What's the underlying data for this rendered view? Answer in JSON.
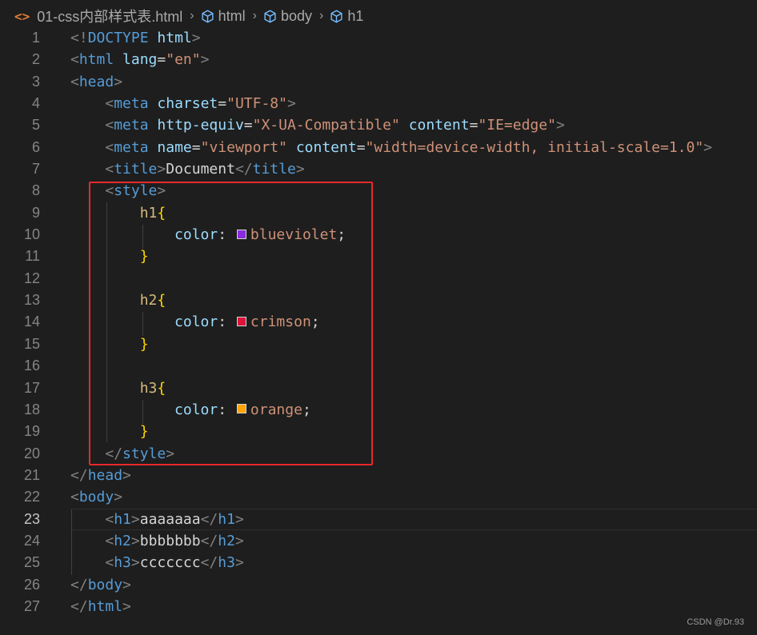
{
  "breadcrumb": {
    "file": "01-css内部样式表.html",
    "crumbs": [
      "html",
      "body",
      "h1"
    ]
  },
  "editor": {
    "active_line": 23,
    "lines": [
      {
        "n": "1",
        "tokens": [
          [
            "punc",
            "<!"
          ],
          [
            "tag",
            "DOCTYPE"
          ],
          [
            "text",
            " "
          ],
          [
            "attr",
            "html"
          ],
          [
            "punc",
            ">"
          ]
        ]
      },
      {
        "n": "2",
        "tokens": [
          [
            "punc",
            "<"
          ],
          [
            "tag",
            "html"
          ],
          [
            "text",
            " "
          ],
          [
            "attr",
            "lang"
          ],
          [
            "text",
            "="
          ],
          [
            "str",
            "\"en\""
          ],
          [
            "punc",
            ">"
          ]
        ]
      },
      {
        "n": "3",
        "tokens": [
          [
            "punc",
            "<"
          ],
          [
            "tag",
            "head"
          ],
          [
            "punc",
            ">"
          ]
        ]
      },
      {
        "n": "4",
        "tokens": [
          [
            "text",
            "    "
          ],
          [
            "punc",
            "<"
          ],
          [
            "tag",
            "meta"
          ],
          [
            "text",
            " "
          ],
          [
            "attr",
            "charset"
          ],
          [
            "text",
            "="
          ],
          [
            "str",
            "\"UTF-8\""
          ],
          [
            "punc",
            ">"
          ]
        ]
      },
      {
        "n": "5",
        "tokens": [
          [
            "text",
            "    "
          ],
          [
            "punc",
            "<"
          ],
          [
            "tag",
            "meta"
          ],
          [
            "text",
            " "
          ],
          [
            "attr",
            "http-equiv"
          ],
          [
            "text",
            "="
          ],
          [
            "str",
            "\"X-UA-Compatible\""
          ],
          [
            "text",
            " "
          ],
          [
            "attr",
            "content"
          ],
          [
            "text",
            "="
          ],
          [
            "str",
            "\"IE=edge\""
          ],
          [
            "punc",
            ">"
          ]
        ]
      },
      {
        "n": "6",
        "tokens": [
          [
            "text",
            "    "
          ],
          [
            "punc",
            "<"
          ],
          [
            "tag",
            "meta"
          ],
          [
            "text",
            " "
          ],
          [
            "attr",
            "name"
          ],
          [
            "text",
            "="
          ],
          [
            "str",
            "\"viewport\""
          ],
          [
            "text",
            " "
          ],
          [
            "attr",
            "content"
          ],
          [
            "text",
            "="
          ],
          [
            "str",
            "\"width=device-width, initial-scale=1.0\""
          ],
          [
            "punc",
            ">"
          ]
        ]
      },
      {
        "n": "7",
        "tokens": [
          [
            "text",
            "    "
          ],
          [
            "punc",
            "<"
          ],
          [
            "tag",
            "title"
          ],
          [
            "punc",
            ">"
          ],
          [
            "text",
            "Document"
          ],
          [
            "punc",
            "</"
          ],
          [
            "tag",
            "title"
          ],
          [
            "punc",
            ">"
          ]
        ]
      },
      {
        "n": "8",
        "tokens": [
          [
            "text",
            "    "
          ],
          [
            "punc",
            "<"
          ],
          [
            "tag",
            "style"
          ],
          [
            "punc",
            ">"
          ]
        ]
      },
      {
        "n": "9",
        "tokens": [
          [
            "text",
            "        "
          ],
          [
            "sel",
            "h1"
          ],
          [
            "brace",
            "{"
          ]
        ]
      },
      {
        "n": "10",
        "tokens": [
          [
            "text",
            "            "
          ],
          [
            "prop",
            "color"
          ],
          [
            "text",
            ": "
          ],
          [
            "swatch",
            "#8a2be2"
          ],
          [
            "val",
            "blueviolet"
          ],
          [
            "text",
            ";"
          ]
        ]
      },
      {
        "n": "11",
        "tokens": [
          [
            "text",
            "        "
          ],
          [
            "brace",
            "}"
          ]
        ]
      },
      {
        "n": "12",
        "tokens": []
      },
      {
        "n": "13",
        "tokens": [
          [
            "text",
            "        "
          ],
          [
            "sel",
            "h2"
          ],
          [
            "brace",
            "{"
          ]
        ]
      },
      {
        "n": "14",
        "tokens": [
          [
            "text",
            "            "
          ],
          [
            "prop",
            "color"
          ],
          [
            "text",
            ": "
          ],
          [
            "swatch",
            "#dc143c"
          ],
          [
            "val",
            "crimson"
          ],
          [
            "text",
            ";"
          ]
        ]
      },
      {
        "n": "15",
        "tokens": [
          [
            "text",
            "        "
          ],
          [
            "brace",
            "}"
          ]
        ]
      },
      {
        "n": "16",
        "tokens": []
      },
      {
        "n": "17",
        "tokens": [
          [
            "text",
            "        "
          ],
          [
            "sel",
            "h3"
          ],
          [
            "brace",
            "{"
          ]
        ]
      },
      {
        "n": "18",
        "tokens": [
          [
            "text",
            "            "
          ],
          [
            "prop",
            "color"
          ],
          [
            "text",
            ": "
          ],
          [
            "swatch",
            "#ffa500"
          ],
          [
            "val",
            "orange"
          ],
          [
            "text",
            ";"
          ]
        ]
      },
      {
        "n": "19",
        "tokens": [
          [
            "text",
            "        "
          ],
          [
            "brace",
            "}"
          ]
        ]
      },
      {
        "n": "20",
        "tokens": [
          [
            "text",
            "    "
          ],
          [
            "punc",
            "</"
          ],
          [
            "tag",
            "style"
          ],
          [
            "punc",
            ">"
          ]
        ]
      },
      {
        "n": "21",
        "tokens": [
          [
            "punc",
            "</"
          ],
          [
            "tag",
            "head"
          ],
          [
            "punc",
            ">"
          ]
        ]
      },
      {
        "n": "22",
        "tokens": [
          [
            "punc",
            "<"
          ],
          [
            "tag",
            "body"
          ],
          [
            "punc",
            ">"
          ]
        ]
      },
      {
        "n": "23",
        "tokens": [
          [
            "text",
            "    "
          ],
          [
            "punc",
            "<"
          ],
          [
            "tag",
            "h1"
          ],
          [
            "punc",
            ">"
          ],
          [
            "text",
            "aaaaaaa"
          ],
          [
            "punc",
            "</"
          ],
          [
            "tag",
            "h1"
          ],
          [
            "punc",
            ">"
          ]
        ]
      },
      {
        "n": "24",
        "tokens": [
          [
            "text",
            "    "
          ],
          [
            "punc",
            "<"
          ],
          [
            "tag",
            "h2"
          ],
          [
            "punc",
            ">"
          ],
          [
            "text",
            "bbbbbbb"
          ],
          [
            "punc",
            "</"
          ],
          [
            "tag",
            "h2"
          ],
          [
            "punc",
            ">"
          ]
        ]
      },
      {
        "n": "25",
        "tokens": [
          [
            "text",
            "    "
          ],
          [
            "punc",
            "<"
          ],
          [
            "tag",
            "h3"
          ],
          [
            "punc",
            ">"
          ],
          [
            "text",
            "ccccccc"
          ],
          [
            "punc",
            "</"
          ],
          [
            "tag",
            "h3"
          ],
          [
            "punc",
            ">"
          ]
        ]
      },
      {
        "n": "26",
        "tokens": [
          [
            "punc",
            "</"
          ],
          [
            "tag",
            "body"
          ],
          [
            "punc",
            ">"
          ]
        ]
      },
      {
        "n": "27",
        "tokens": [
          [
            "punc",
            "</"
          ],
          [
            "tag",
            "html"
          ],
          [
            "punc",
            ">"
          ]
        ]
      }
    ]
  },
  "colors": {
    "background": "#1e1e1e",
    "tag": "#569cd6",
    "attribute": "#9cdcfe",
    "string": "#ce9178",
    "selector": "#d7ba7d",
    "brace": "#ffd700",
    "highlight_box": "#e8292c"
  },
  "icons": {
    "file": "html-file-icon",
    "crumb": "cube-icon"
  },
  "watermark": "CSDN @Dr.93"
}
